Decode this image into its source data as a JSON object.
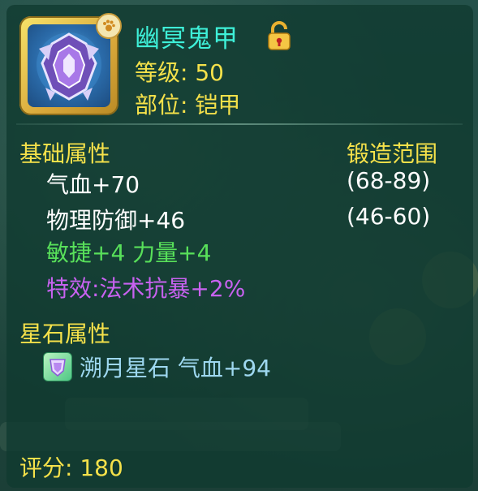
{
  "item": {
    "name": "幽冥鬼甲",
    "icon": "armor-icon",
    "badge_icon": "paw-icon",
    "lock_icon": "unlocked-padlock-icon",
    "level_label": "等级",
    "level_sep": ":",
    "level_value": "50",
    "slot_label": "部位",
    "slot_sep": ":",
    "slot_value": "铠甲"
  },
  "base": {
    "heading": "基础属性",
    "range_heading": "锻造范围",
    "stats": [
      {
        "label": "气血+70",
        "range": "(68-89)"
      },
      {
        "label": "物理防御+46",
        "range": "(46-60)"
      }
    ],
    "bonus": "敏捷+4 力量+4",
    "effect": "特效:法术抗暴+2%"
  },
  "star": {
    "heading": "星石属性",
    "gem_icon": "star-stone-icon",
    "line": "溯月星石 气血+94"
  },
  "score": {
    "label": "评分",
    "sep": ":",
    "value": "180"
  },
  "colors": {
    "name": "#3ef0d8",
    "heading": "#f5e14a",
    "bonus": "#58e05a",
    "effect": "#c862f0"
  }
}
